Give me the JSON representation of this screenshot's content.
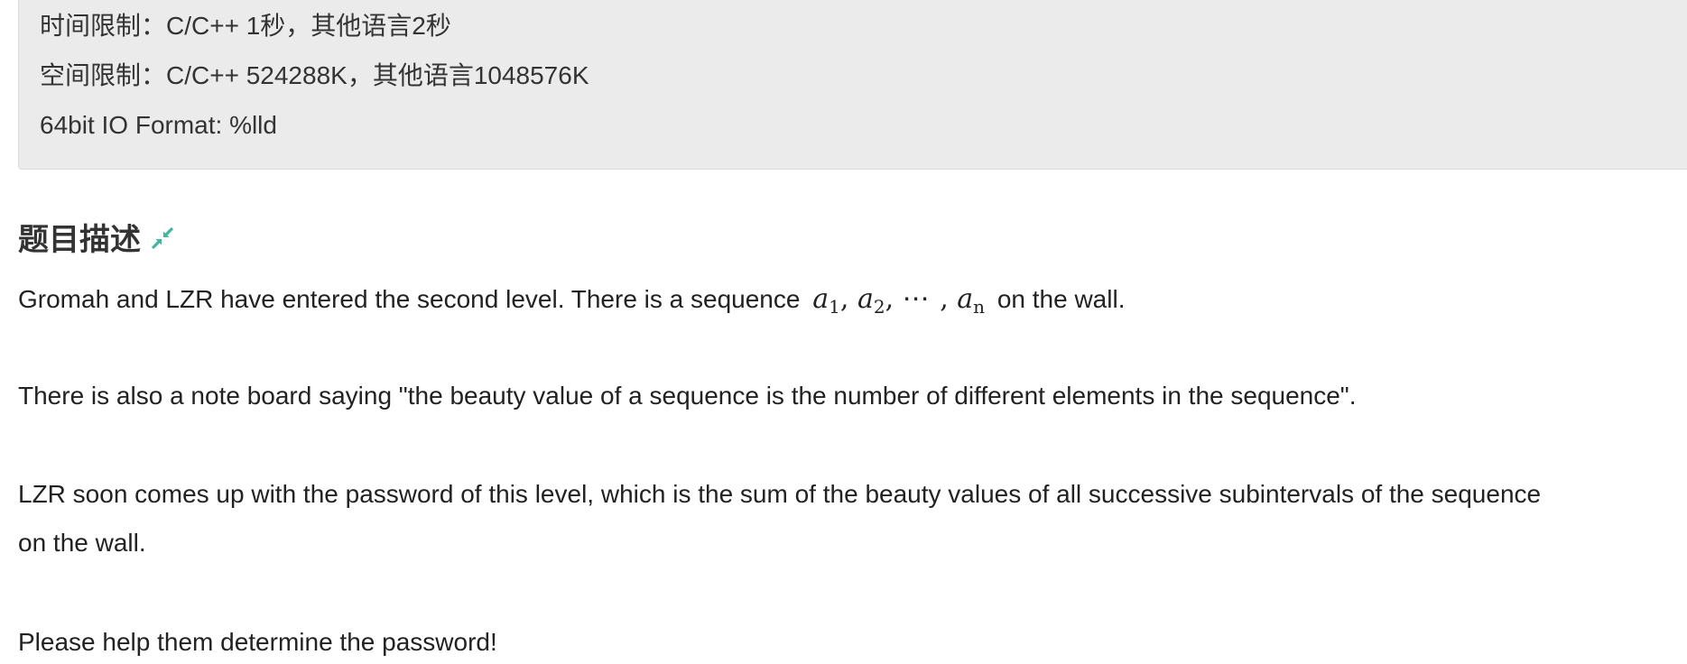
{
  "limits": {
    "time": "时间限制：C/C++ 1秒，其他语言2秒",
    "space": "空间限制：C/C++ 524288K，其他语言1048576K",
    "io_format": "64bit IO Format: %lld"
  },
  "section": {
    "title": "题目描述",
    "collapse_icon": "compress-arrows-icon",
    "icon_color": "#3cb89b"
  },
  "description": {
    "p1_before": "Gromah and LZR have entered the second level. There is a sequence",
    "p1_after": "on the wall.",
    "p2": "There is also a note board saying \"the beauty value of a sequence is the number of different elements in the sequence\".",
    "p3_line1": "LZR soon comes up with the password of this level, which is the sum of the beauty values of all successive subintervals of the sequence",
    "p3_line2": "on the wall.",
    "p4": "Please help them determine the password!"
  },
  "formula": {
    "var": "a",
    "sub1": "1",
    "sub2": "2",
    "ellipsis": "⋯",
    "subn": "n"
  }
}
